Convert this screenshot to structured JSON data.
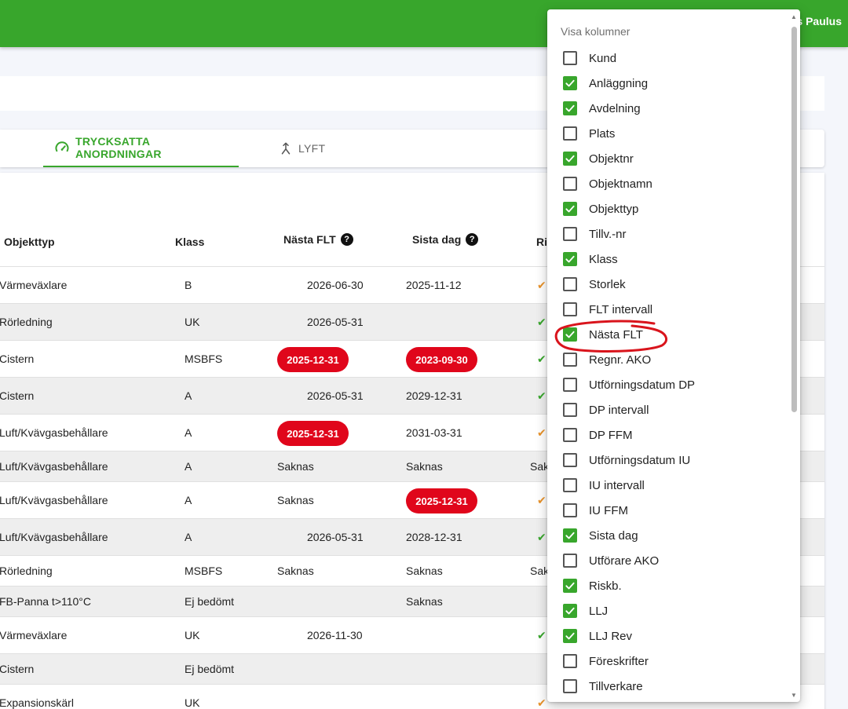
{
  "topbar": {
    "user_name": "s Paulus",
    "accent": "#38a62c"
  },
  "tabs": [
    {
      "label": "TRYCKSATTA ANORDNINGAR",
      "icon": "gauge-icon",
      "active": true
    },
    {
      "label": "LYFT",
      "icon": "merge-arrow-icon",
      "active": false
    }
  ],
  "table": {
    "headers": {
      "objekttyp": "Objekttyp",
      "klass": "Klass",
      "nasta_flt": "Nästa FLT",
      "sista_dag": "Sista dag",
      "risk": "Ris"
    },
    "rows": [
      {
        "objekttyp": "Värmeväxlare",
        "klass": "B",
        "nasta_flt": "2026-06-30",
        "sista_dag": "2025-11-12",
        "risk": "✔"
      },
      {
        "objekttyp": "Rörledning",
        "klass": "UK",
        "nasta_flt": "2026-05-31",
        "sista_dag": "",
        "risk": "✔"
      },
      {
        "objekttyp": "Cistern",
        "klass": "MSBFS",
        "nasta_flt": "2025-12-31",
        "sista_dag": "2023-09-30",
        "risk": "✔"
      },
      {
        "objekttyp": "Cistern",
        "klass": "A",
        "nasta_flt": "2026-05-31",
        "sista_dag": "2029-12-31",
        "risk": "✔"
      },
      {
        "objekttyp": "Luft/Kvävgasbehållare",
        "klass": "A",
        "nasta_flt": "2025-12-31",
        "sista_dag": "2031-03-31",
        "risk": "✔"
      },
      {
        "objekttyp": "Luft/Kvävgasbehållare",
        "klass": "A",
        "nasta_flt": "Saknas",
        "sista_dag": "Saknas",
        "risk": "Sak"
      },
      {
        "objekttyp": "Luft/Kvävgasbehållare",
        "klass": "A",
        "nasta_flt": "Saknas",
        "sista_dag": "2025-12-31",
        "risk": "✔"
      },
      {
        "objekttyp": "Luft/Kvävgasbehållare",
        "klass": "A",
        "nasta_flt": "2026-05-31",
        "sista_dag": "2028-12-31",
        "risk": "✔"
      },
      {
        "objekttyp": "Rörledning",
        "klass": "MSBFS",
        "nasta_flt": "Saknas",
        "sista_dag": "Saknas",
        "risk": "Sak"
      },
      {
        "objekttyp": "FB-Panna t>110°C",
        "klass": "Ej bedömt",
        "nasta_flt": "",
        "sista_dag": "Saknas",
        "risk": ""
      },
      {
        "objekttyp": "Värmeväxlare",
        "klass": "UK",
        "nasta_flt": "2026-11-30",
        "sista_dag": "",
        "risk": "✔"
      },
      {
        "objekttyp": "Cistern",
        "klass": "Ej bedömt",
        "nasta_flt": "",
        "sista_dag": "",
        "risk": ""
      },
      {
        "objekttyp": "Expansionskärl",
        "klass": "UK",
        "nasta_flt": "",
        "sista_dag": "",
        "risk": "✔"
      }
    ]
  },
  "column_menu": {
    "title": "Visa kolumner",
    "items": [
      {
        "label": "Kund",
        "checked": false
      },
      {
        "label": "Anläggning",
        "checked": true
      },
      {
        "label": "Avdelning",
        "checked": true
      },
      {
        "label": "Plats",
        "checked": false
      },
      {
        "label": "Objektnr",
        "checked": true
      },
      {
        "label": "Objektnamn",
        "checked": false
      },
      {
        "label": "Objekttyp",
        "checked": true
      },
      {
        "label": "Tillv.-nr",
        "checked": false
      },
      {
        "label": "Klass",
        "checked": true
      },
      {
        "label": "Storlek",
        "checked": false
      },
      {
        "label": "FLT intervall",
        "checked": false
      },
      {
        "label": "Nästa FLT",
        "checked": true
      },
      {
        "label": "Regnr. AKO",
        "checked": false
      },
      {
        "label": "Utförningsdatum DP",
        "checked": false
      },
      {
        "label": "DP intervall",
        "checked": false
      },
      {
        "label": "DP FFM",
        "checked": false
      },
      {
        "label": "Utförningsdatum IU",
        "checked": false
      },
      {
        "label": "IU intervall",
        "checked": false
      },
      {
        "label": "IU FFM",
        "checked": false
      },
      {
        "label": "Sista dag",
        "checked": true
      },
      {
        "label": "Utförare AKO",
        "checked": false
      },
      {
        "label": "Riskb.",
        "checked": true
      },
      {
        "label": "LLJ",
        "checked": true
      },
      {
        "label": "LLJ Rev",
        "checked": true
      },
      {
        "label": "Föreskrifter",
        "checked": false
      },
      {
        "label": "Tillverkare",
        "checked": false
      }
    ]
  },
  "colors": {
    "overdue_pill": "#e0061b",
    "check_green": "#38a62c",
    "check_orange": "#e8922a",
    "annotation": "#d9141c"
  }
}
